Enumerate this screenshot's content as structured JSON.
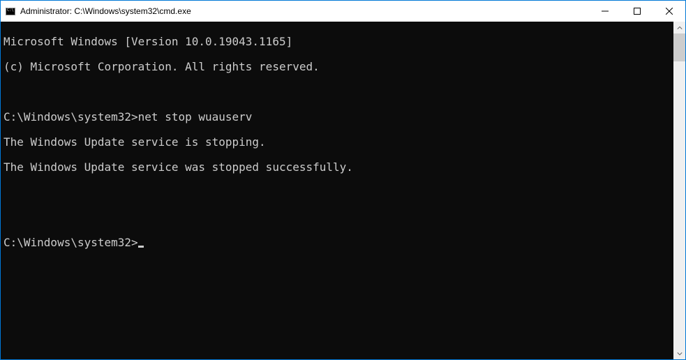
{
  "window": {
    "title": "Administrator: C:\\Windows\\system32\\cmd.exe"
  },
  "console": {
    "lines": [
      "Microsoft Windows [Version 10.0.19043.1165]",
      "(c) Microsoft Corporation. All rights reserved.",
      "",
      "C:\\Windows\\system32>net stop wuauserv",
      "The Windows Update service is stopping.",
      "The Windows Update service was stopped successfully.",
      "",
      ""
    ],
    "current_prompt": "C:\\Windows\\system32>"
  }
}
